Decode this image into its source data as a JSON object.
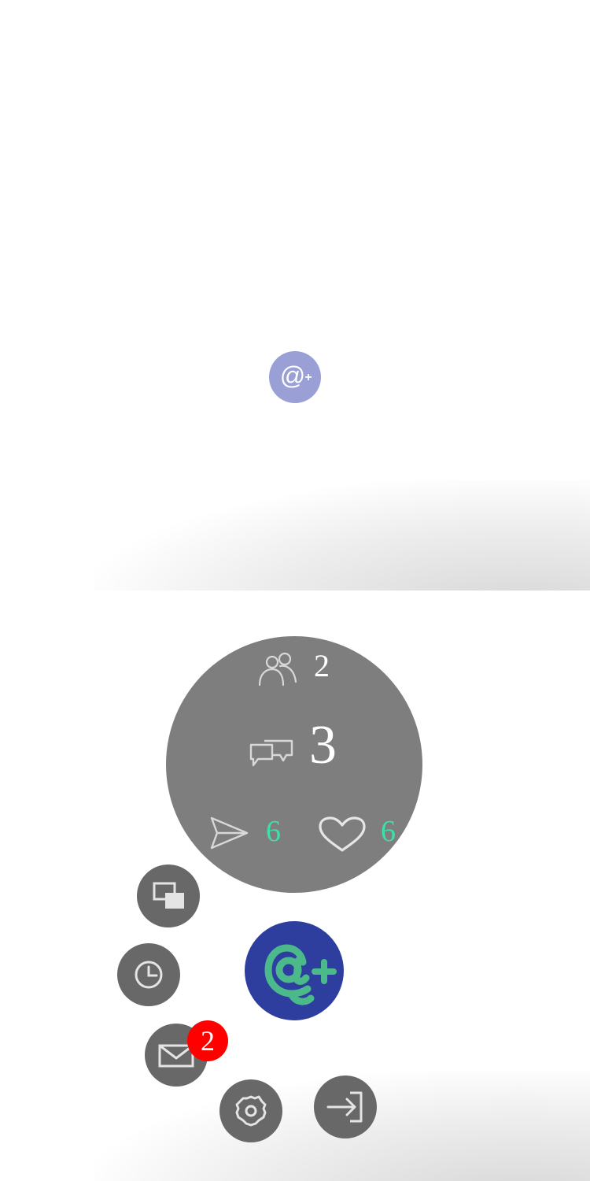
{
  "top_panel": {
    "logo": {
      "icon": "at-plus-logo-icon",
      "color": "#9aa0d6"
    }
  },
  "bottom_panel": {
    "stats": {
      "users_icon": "people-icon",
      "users_count": "2",
      "conversations_icon": "chat-bubbles-icon",
      "conversations_count": "3",
      "sent_icon": "paper-plane-icon",
      "sent_count": "6",
      "likes_icon": "heart-icon",
      "likes_count": "6",
      "accent_color": "#3fe0a8"
    },
    "logo": {
      "icon": "at-plus-logo-icon",
      "color": "#2e3e9e",
      "glyph_color": "#4cb98a"
    },
    "menu": [
      {
        "name": "windows",
        "icon": "windows-icon"
      },
      {
        "name": "history",
        "icon": "clock-icon"
      },
      {
        "name": "messages",
        "icon": "envelope-icon",
        "badge": "2"
      },
      {
        "name": "settings",
        "icon": "gear-icon"
      },
      {
        "name": "logout",
        "icon": "exit-icon"
      }
    ]
  }
}
